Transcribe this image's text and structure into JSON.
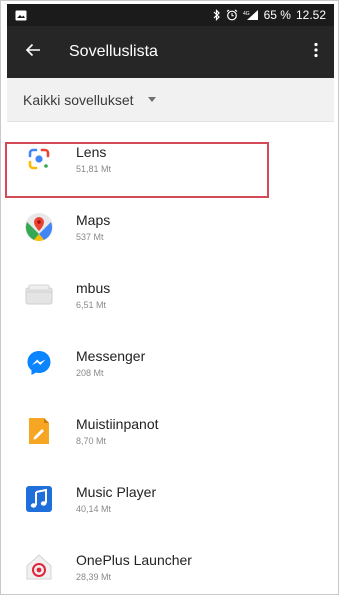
{
  "status_bar": {
    "battery_text": "65 %",
    "time": "12.52"
  },
  "app_bar": {
    "title": "Sovelluslista"
  },
  "filter": {
    "selected": "Kaikki sovellukset"
  },
  "apps": [
    {
      "name": "Lens",
      "size": "51,81 Mt",
      "icon": "lens-icon"
    },
    {
      "name": "Maps",
      "size": "537 Mt",
      "icon": "maps-icon"
    },
    {
      "name": "mbus",
      "size": "6,51 Mt",
      "icon": "mbus-icon",
      "highlighted": true
    },
    {
      "name": "Messenger",
      "size": "208 Mt",
      "icon": "messenger-icon"
    },
    {
      "name": "Muistiinpanot",
      "size": "8,70 Mt",
      "icon": "notes-icon"
    },
    {
      "name": "Music Player",
      "size": "40,14 Mt",
      "icon": "music-player-icon"
    },
    {
      "name": "OnePlus Launcher",
      "size": "28,39 Mt",
      "icon": "launcher-icon"
    }
  ],
  "colors": {
    "status_bar": "#1b1b1b",
    "app_bar": "#262626",
    "highlight": "#d44a57"
  }
}
